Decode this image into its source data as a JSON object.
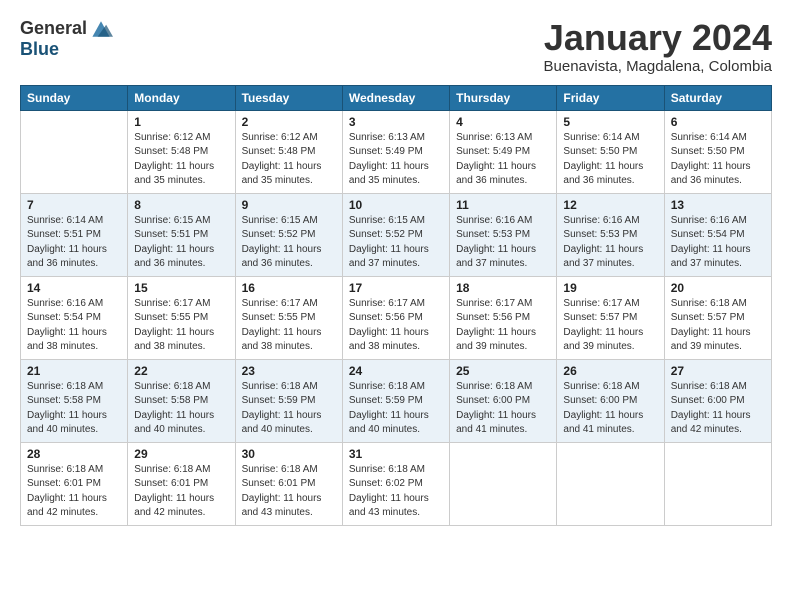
{
  "logo": {
    "general": "General",
    "blue": "Blue"
  },
  "title": "January 2024",
  "location": "Buenavista, Magdalena, Colombia",
  "days_header": [
    "Sunday",
    "Monday",
    "Tuesday",
    "Wednesday",
    "Thursday",
    "Friday",
    "Saturday"
  ],
  "weeks": [
    [
      {
        "day": "",
        "info": ""
      },
      {
        "day": "1",
        "info": "Sunrise: 6:12 AM\nSunset: 5:48 PM\nDaylight: 11 hours\nand 35 minutes."
      },
      {
        "day": "2",
        "info": "Sunrise: 6:12 AM\nSunset: 5:48 PM\nDaylight: 11 hours\nand 35 minutes."
      },
      {
        "day": "3",
        "info": "Sunrise: 6:13 AM\nSunset: 5:49 PM\nDaylight: 11 hours\nand 35 minutes."
      },
      {
        "day": "4",
        "info": "Sunrise: 6:13 AM\nSunset: 5:49 PM\nDaylight: 11 hours\nand 36 minutes."
      },
      {
        "day": "5",
        "info": "Sunrise: 6:14 AM\nSunset: 5:50 PM\nDaylight: 11 hours\nand 36 minutes."
      },
      {
        "day": "6",
        "info": "Sunrise: 6:14 AM\nSunset: 5:50 PM\nDaylight: 11 hours\nand 36 minutes."
      }
    ],
    [
      {
        "day": "7",
        "info": "Sunrise: 6:14 AM\nSunset: 5:51 PM\nDaylight: 11 hours\nand 36 minutes."
      },
      {
        "day": "8",
        "info": "Sunrise: 6:15 AM\nSunset: 5:51 PM\nDaylight: 11 hours\nand 36 minutes."
      },
      {
        "day": "9",
        "info": "Sunrise: 6:15 AM\nSunset: 5:52 PM\nDaylight: 11 hours\nand 36 minutes."
      },
      {
        "day": "10",
        "info": "Sunrise: 6:15 AM\nSunset: 5:52 PM\nDaylight: 11 hours\nand 37 minutes."
      },
      {
        "day": "11",
        "info": "Sunrise: 6:16 AM\nSunset: 5:53 PM\nDaylight: 11 hours\nand 37 minutes."
      },
      {
        "day": "12",
        "info": "Sunrise: 6:16 AM\nSunset: 5:53 PM\nDaylight: 11 hours\nand 37 minutes."
      },
      {
        "day": "13",
        "info": "Sunrise: 6:16 AM\nSunset: 5:54 PM\nDaylight: 11 hours\nand 37 minutes."
      }
    ],
    [
      {
        "day": "14",
        "info": "Sunrise: 6:16 AM\nSunset: 5:54 PM\nDaylight: 11 hours\nand 38 minutes."
      },
      {
        "day": "15",
        "info": "Sunrise: 6:17 AM\nSunset: 5:55 PM\nDaylight: 11 hours\nand 38 minutes."
      },
      {
        "day": "16",
        "info": "Sunrise: 6:17 AM\nSunset: 5:55 PM\nDaylight: 11 hours\nand 38 minutes."
      },
      {
        "day": "17",
        "info": "Sunrise: 6:17 AM\nSunset: 5:56 PM\nDaylight: 11 hours\nand 38 minutes."
      },
      {
        "day": "18",
        "info": "Sunrise: 6:17 AM\nSunset: 5:56 PM\nDaylight: 11 hours\nand 39 minutes."
      },
      {
        "day": "19",
        "info": "Sunrise: 6:17 AM\nSunset: 5:57 PM\nDaylight: 11 hours\nand 39 minutes."
      },
      {
        "day": "20",
        "info": "Sunrise: 6:18 AM\nSunset: 5:57 PM\nDaylight: 11 hours\nand 39 minutes."
      }
    ],
    [
      {
        "day": "21",
        "info": "Sunrise: 6:18 AM\nSunset: 5:58 PM\nDaylight: 11 hours\nand 40 minutes."
      },
      {
        "day": "22",
        "info": "Sunrise: 6:18 AM\nSunset: 5:58 PM\nDaylight: 11 hours\nand 40 minutes."
      },
      {
        "day": "23",
        "info": "Sunrise: 6:18 AM\nSunset: 5:59 PM\nDaylight: 11 hours\nand 40 minutes."
      },
      {
        "day": "24",
        "info": "Sunrise: 6:18 AM\nSunset: 5:59 PM\nDaylight: 11 hours\nand 40 minutes."
      },
      {
        "day": "25",
        "info": "Sunrise: 6:18 AM\nSunset: 6:00 PM\nDaylight: 11 hours\nand 41 minutes."
      },
      {
        "day": "26",
        "info": "Sunrise: 6:18 AM\nSunset: 6:00 PM\nDaylight: 11 hours\nand 41 minutes."
      },
      {
        "day": "27",
        "info": "Sunrise: 6:18 AM\nSunset: 6:00 PM\nDaylight: 11 hours\nand 42 minutes."
      }
    ],
    [
      {
        "day": "28",
        "info": "Sunrise: 6:18 AM\nSunset: 6:01 PM\nDaylight: 11 hours\nand 42 minutes."
      },
      {
        "day": "29",
        "info": "Sunrise: 6:18 AM\nSunset: 6:01 PM\nDaylight: 11 hours\nand 42 minutes."
      },
      {
        "day": "30",
        "info": "Sunrise: 6:18 AM\nSunset: 6:01 PM\nDaylight: 11 hours\nand 43 minutes."
      },
      {
        "day": "31",
        "info": "Sunrise: 6:18 AM\nSunset: 6:02 PM\nDaylight: 11 hours\nand 43 minutes."
      },
      {
        "day": "",
        "info": ""
      },
      {
        "day": "",
        "info": ""
      },
      {
        "day": "",
        "info": ""
      }
    ]
  ]
}
